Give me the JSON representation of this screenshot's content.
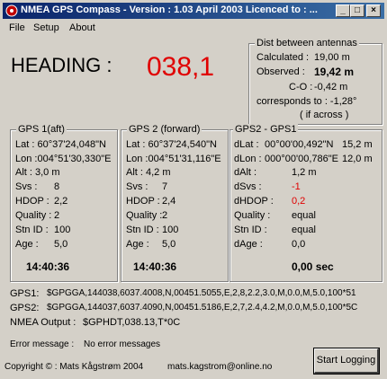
{
  "window": {
    "title": "NMEA GPS Compass - Version : 1.03 April 2003   Licenced to : ..."
  },
  "menu": [
    "File",
    "Setup",
    "About"
  ],
  "heading": {
    "label": "HEADING :",
    "value": "038,1"
  },
  "dist": {
    "title": "Dist between antennas",
    "calculated_label": "Calculated :",
    "calculated_value": "19,00 m",
    "observed_label": "Observed :",
    "observed_value": "19,42 m",
    "co_label": "C-O :",
    "co_value": "-0,42 m",
    "corresponds": "corresponds to : -1,28°",
    "if_across": "( if across )"
  },
  "gps1": {
    "title": "GPS 1(aft)",
    "lat": "Lat : 60°37'24,048\"N",
    "lon": "Lon :004°51'30,330\"E",
    "alt": "Alt : 3,0 m",
    "svs_label": "Svs :",
    "svs_value": "8",
    "hdop_label": "HDOP :",
    "hdop_value": "2,2",
    "quality_label": "Quality :",
    "quality_value": "2",
    "stn_label": "Stn ID :",
    "stn_value": "100",
    "age_label": "Age :",
    "age_value": "5,0",
    "time": "14:40:36"
  },
  "gps2": {
    "title": "GPS 2 (forward)",
    "lat": "Lat : 60°37'24,540\"N",
    "lon": "Lon :004°51'31,116\"E",
    "alt": "Alt : 4,2 m",
    "svs_label": "Svs :",
    "svs_value": "7",
    "hdop_label": "HDOP :",
    "hdop_value": "2,4",
    "quality_label": "Quality :",
    "quality_value": "2",
    "stn_label": "Stn ID :",
    "stn_value": "100",
    "age_label": "Age :",
    "age_value": "5,0",
    "time": "14:40:36"
  },
  "diff": {
    "title": "GPS2 - GPS1",
    "dlat_label": "dLat :",
    "dlat_value": "00°00'00,492\"N",
    "dlat_m": "15,2 m",
    "dlon_label": "dLon :",
    "dlon_value": "000°00'00,786\"E",
    "dlon_m": "12,0 m",
    "dalt_label": "dAlt :",
    "dalt_value": "1,2 m",
    "dsvs_label": "dSvs :",
    "dsvs_value": "-1",
    "dhdop_label": "dHDOP :",
    "dhdop_value": "0,2",
    "quality_label": "Quality :",
    "quality_value": "equal",
    "stn_label": "Stn ID :",
    "stn_value": "equal",
    "dage_label": "dAge :",
    "dage_value": "0,0",
    "sec": "0,00 sec"
  },
  "nmea": {
    "gps1_label": "GPS1:",
    "gps1_value": "$GPGGA,144038,6037.4008,N,00451.5055,E,2,8,2.2,3.0,M,0.0,M,5.0,100*51",
    "gps2_label": "GPS2:",
    "gps2_value": "$GPGGA,144037,6037.4090,N,00451.5186,E,2,7,2.4,4.2,M,0.0,M,5.0,100*5C",
    "out_label": "NMEA Output :",
    "out_value": "$GPHDT,038.13,T*0C"
  },
  "error": {
    "label": "Error message :",
    "value": "No error messages"
  },
  "footer": {
    "copyright": "Copyright  © : Mats Kågstrøm 2004",
    "email": "mats.kagstrom@online.no",
    "button": "Start Logging"
  },
  "colors": {
    "title_start": "#0a246a",
    "title_end": "#3a6ea5",
    "heading": "#e00000",
    "negative": "#e00000"
  }
}
